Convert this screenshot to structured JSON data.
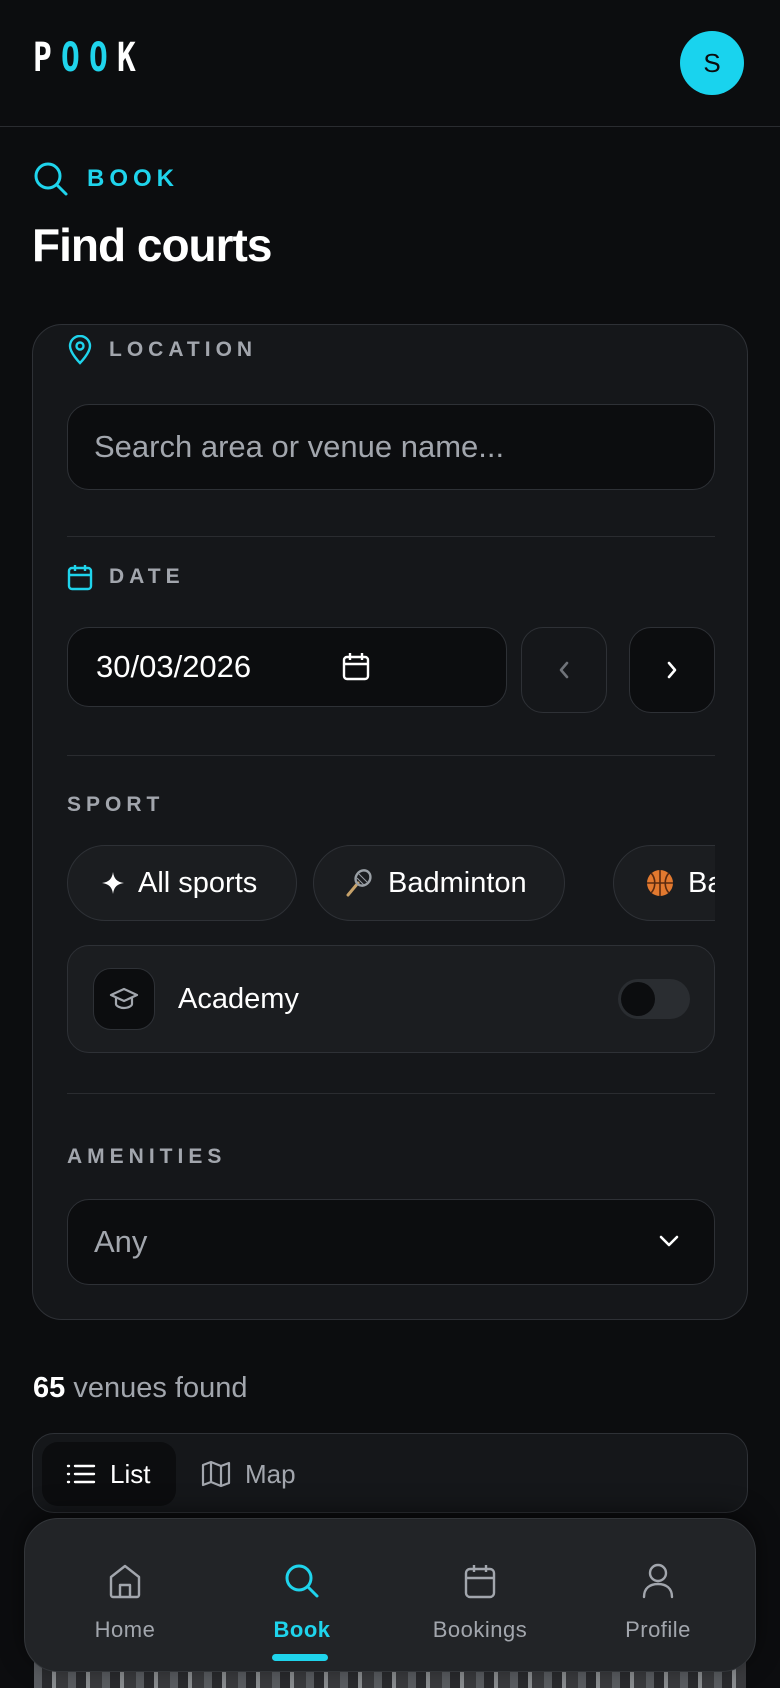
{
  "header": {
    "logo_letters": [
      "P",
      "O",
      "O",
      "K"
    ],
    "avatar_initial": "S"
  },
  "page": {
    "eyebrow": "BOOK",
    "title": "Find courts"
  },
  "filters": {
    "location": {
      "label": "LOCATION",
      "placeholder": "Search area or venue name..."
    },
    "date": {
      "label": "DATE",
      "value": "30/03/2026"
    },
    "sport": {
      "label": "SPORT",
      "chips": [
        {
          "icon": "sparkle-icon",
          "label": "All sports"
        },
        {
          "icon": "badminton-icon",
          "label": "Badminton"
        },
        {
          "icon": "basketball-icon",
          "label": "Basketball"
        }
      ]
    },
    "academy": {
      "label": "Academy",
      "enabled": false
    },
    "amenities": {
      "label": "AMENITIES",
      "value": "Any"
    }
  },
  "results": {
    "count": "65",
    "count_suffix": "venues found"
  },
  "view_switch": {
    "list_label": "List",
    "map_label": "Map",
    "selected": "List"
  },
  "tabbar": {
    "items": [
      {
        "label": "Home",
        "icon": "home-icon"
      },
      {
        "label": "Book",
        "icon": "search-icon"
      },
      {
        "label": "Bookings",
        "icon": "calendar-icon"
      },
      {
        "label": "Profile",
        "icon": "user-icon"
      }
    ],
    "active": "Book"
  },
  "colors": {
    "accent": "#1fd4ec",
    "background": "#0c0d0f",
    "card": "#15171a"
  }
}
